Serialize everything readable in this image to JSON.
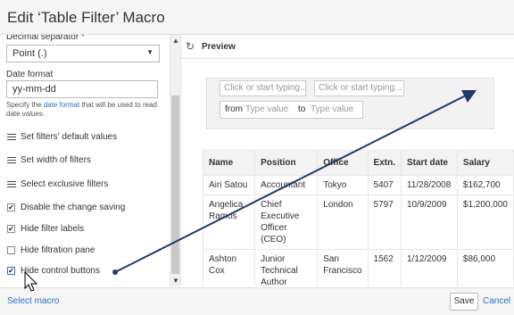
{
  "window": {
    "title": "Edit ‘Table Filter’ Macro"
  },
  "sidebar": {
    "decimal_label": "Decimal separator *",
    "decimal_value": "Point (.)",
    "date_format_label": "Date format",
    "date_format_value": "yy-mm-dd",
    "help_pre": "Specify the ",
    "help_link": "date format",
    "help_post": " that will be used to read date values.",
    "links": [
      {
        "label": "Set filters' default values",
        "icon": "list-icon"
      },
      {
        "label": "Set width of filters",
        "icon": "list-icon"
      },
      {
        "label": "Select exclusive filters",
        "icon": "list-icon"
      }
    ],
    "checkboxes": [
      {
        "label": "Disable the change saving",
        "checked": true
      },
      {
        "label": "Hide filter labels",
        "checked": true
      },
      {
        "label": "Hide filtration pane",
        "checked": false
      },
      {
        "label": "Hide control buttons",
        "checked": true
      }
    ]
  },
  "preview": {
    "title": "Preview",
    "filter1_placeholder": "Click or start typing...",
    "filter2_placeholder": "Click or start typing...",
    "from_label": "from",
    "from_placeholder": "Type value",
    "to_label": "to",
    "to_placeholder": "Type value",
    "columns": [
      "Name",
      "Position",
      "Office",
      "Extn.",
      "Start date",
      "Salary"
    ],
    "rows": [
      [
        "Airi Satou",
        "Accountant",
        "Tokyo",
        "5407",
        "11/28/2008",
        "$162,700"
      ],
      [
        "Angelica Ramos",
        "Chief Executive Officer (CEO)",
        "London",
        "5797",
        "10/9/2009",
        "$1,200,000"
      ],
      [
        "Ashton Cox",
        "Junior Technical Author",
        "San Francisco",
        "1562",
        "1/12/2009",
        "$86,000"
      ]
    ]
  },
  "footer": {
    "select_macro": "Select macro",
    "save": "Save",
    "cancel": "Cancel"
  },
  "colors": {
    "link": "#2a6fc9",
    "arrow": "#1f3a6e"
  }
}
